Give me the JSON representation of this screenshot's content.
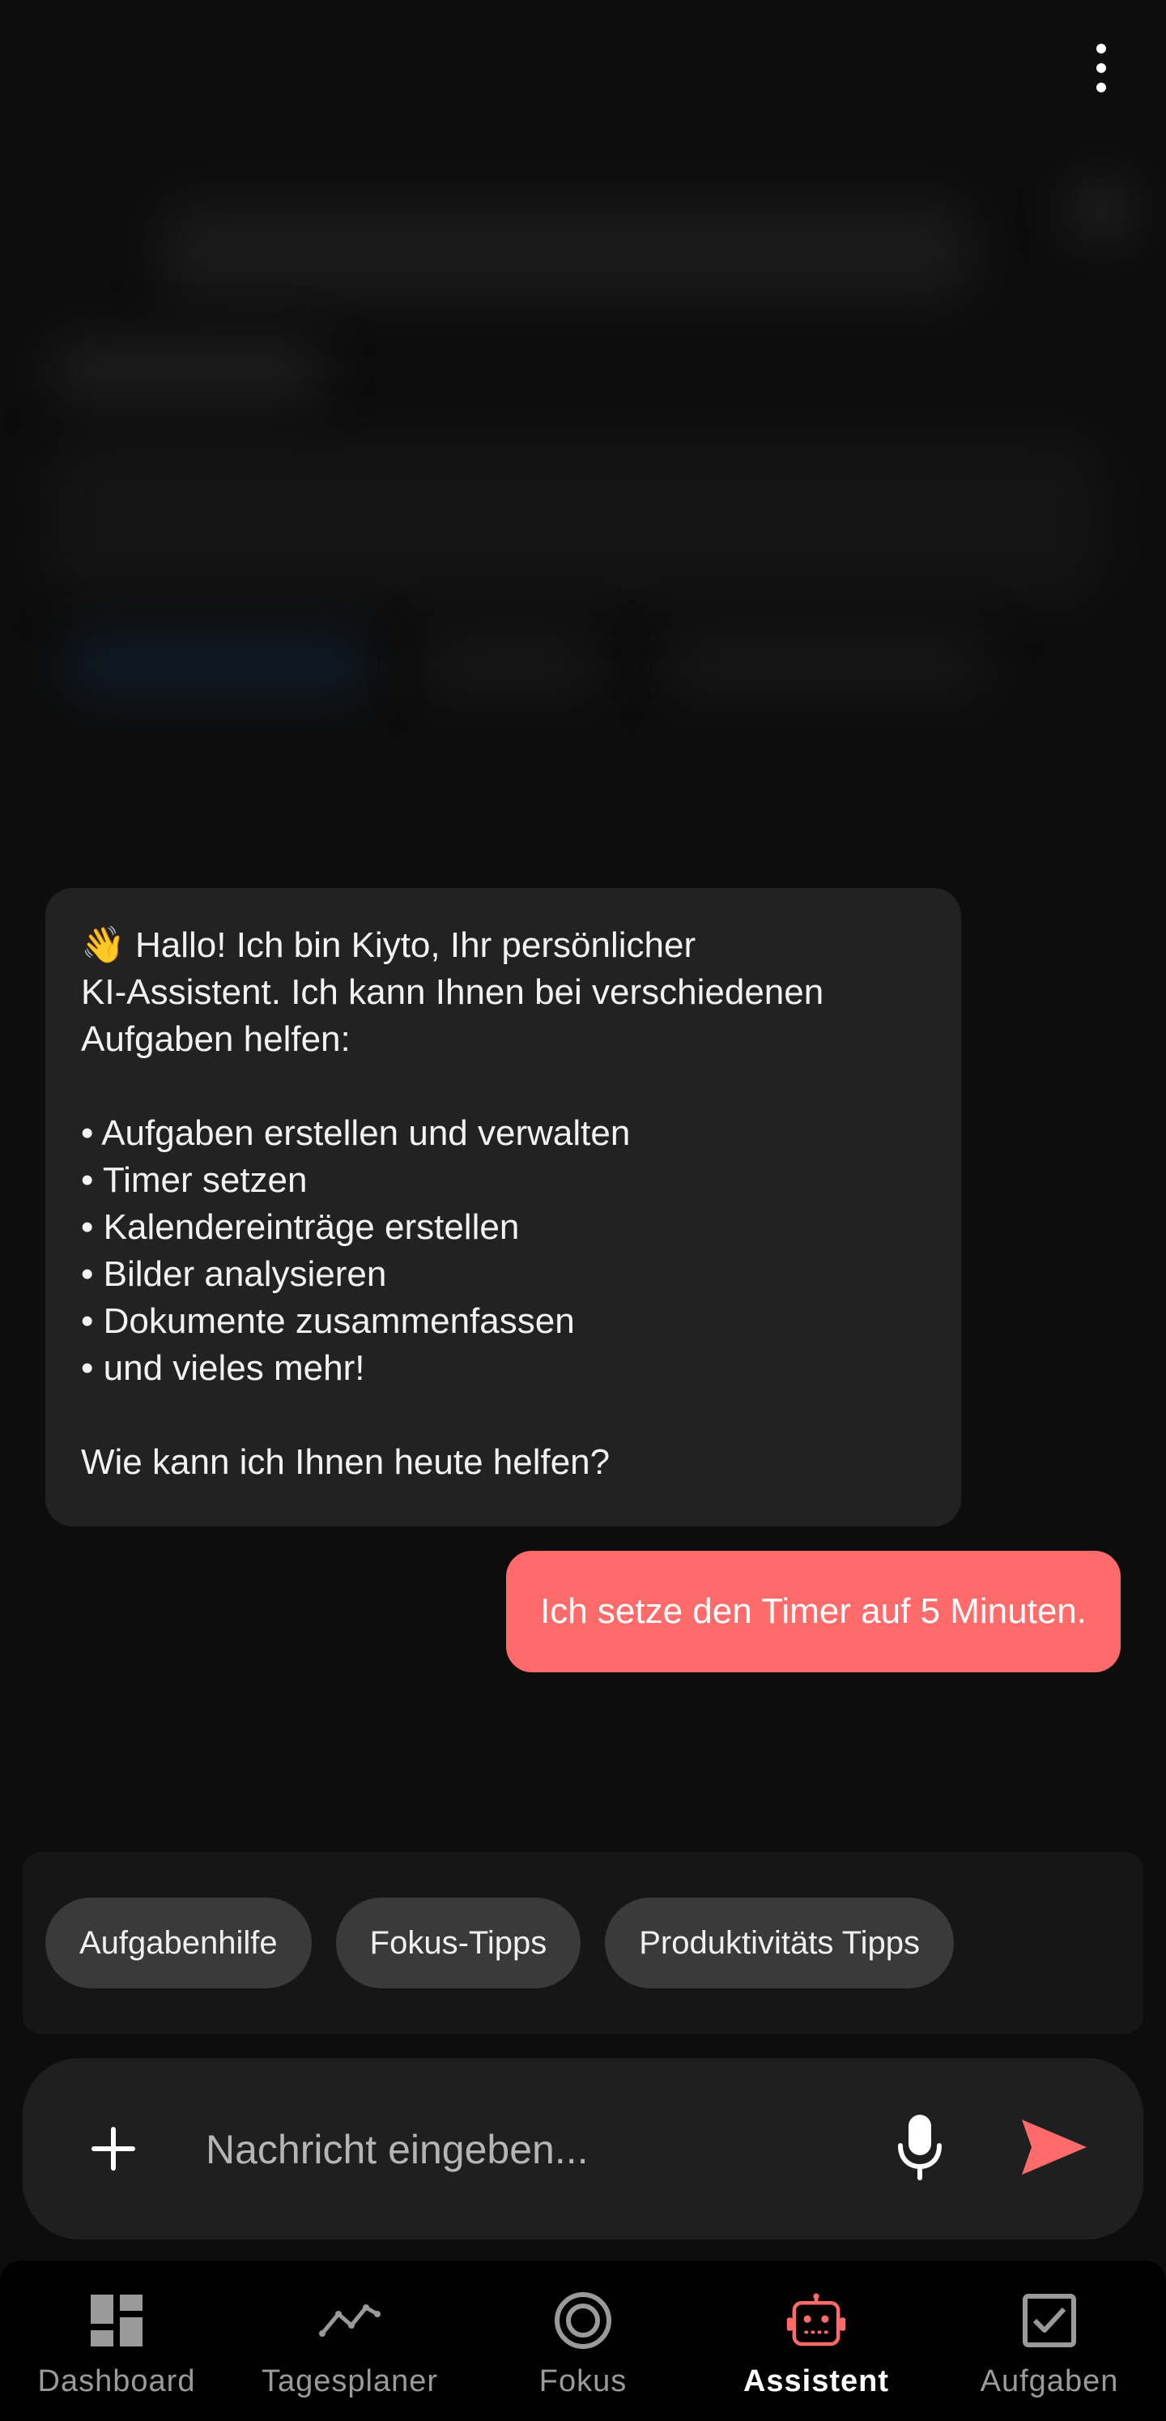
{
  "app": {
    "accent_color": "#ff6b6b",
    "background_color": "#0d0d0d"
  },
  "header": {
    "menu_icon": "more-vertical-icon"
  },
  "chat": {
    "messages": [
      {
        "role": "assistant",
        "lines": [
          "👋 Hallo! Ich bin Kiyto, Ihr persönlicher",
          "KI-Assistent. Ich kann Ihnen bei verschiedenen",
          "Aufgaben helfen:",
          "",
          "• Aufgaben erstellen und verwalten",
          "• Timer setzen",
          "• Kalendereinträge erstellen",
          "• Bilder analysieren",
          "• Dokumente zusammenfassen",
          "• und vieles mehr!",
          "",
          "Wie kann ich Ihnen heute helfen?"
        ]
      },
      {
        "role": "user",
        "text": "Ich setze den Timer auf 5 Minuten."
      }
    ]
  },
  "suggestions": {
    "chips": [
      "Aufgabenhilfe",
      "Fokus-Tipps",
      "Produktivitäts Tipps"
    ]
  },
  "composer": {
    "placeholder": "Nachricht eingeben...",
    "add_icon": "plus-icon",
    "mic_icon": "microphone-icon",
    "send_icon": "send-icon"
  },
  "nav": {
    "items": [
      {
        "label": "Dashboard",
        "icon": "dashboard-icon",
        "active": false
      },
      {
        "label": "Tagesplaner",
        "icon": "trend-line-icon",
        "active": false
      },
      {
        "label": "Fokus",
        "icon": "target-icon",
        "active": false
      },
      {
        "label": "Assistent",
        "icon": "robot-icon",
        "active": true
      },
      {
        "label": "Aufgaben",
        "icon": "checkbox-icon",
        "active": false
      }
    ]
  }
}
